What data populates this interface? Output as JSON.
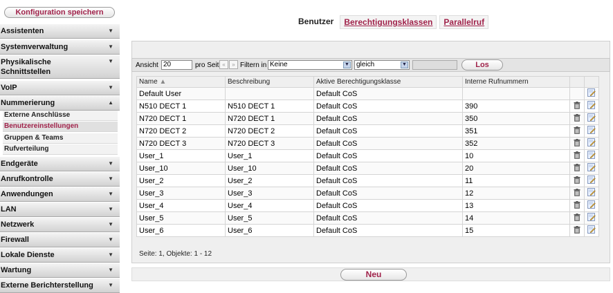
{
  "sidebar": {
    "save_label": "Konfiguration speichern",
    "items": [
      {
        "label": "Assistenten"
      },
      {
        "label": "Systemverwaltung"
      },
      {
        "label": "Physikalische Schnittstellen"
      },
      {
        "label": "VoIP"
      },
      {
        "label": "Nummerierung"
      },
      {
        "label": "Endgeräte"
      },
      {
        "label": "Anrufkontrolle"
      },
      {
        "label": "Anwendungen"
      },
      {
        "label": "LAN"
      },
      {
        "label": "Netzwerk"
      },
      {
        "label": "Firewall"
      },
      {
        "label": "Lokale Dienste"
      },
      {
        "label": "Wartung"
      },
      {
        "label": "Externe Berichterstellung"
      }
    ],
    "sub_items": [
      {
        "label": "Externe Anschlüsse"
      },
      {
        "label": "Benutzereinstellungen"
      },
      {
        "label": "Gruppen & Teams"
      },
      {
        "label": "Rufverteilung"
      }
    ]
  },
  "tabs": [
    {
      "label": "Benutzer"
    },
    {
      "label": "Berechtigungsklassen"
    },
    {
      "label": "Parallelruf"
    }
  ],
  "filter": {
    "view_label": "Ansicht",
    "view_value": "20",
    "per_page_label": "pro Seite",
    "filter_in_label": "Filtern in",
    "filter_field": "Keine",
    "operator": "gleich",
    "go_label": "Los"
  },
  "table": {
    "headers": [
      "Name",
      "Beschreibung",
      "Aktive Berechtigungsklasse",
      "Interne Rufnummern"
    ],
    "rows": [
      [
        "Default User",
        "",
        "Default CoS",
        ""
      ],
      [
        "N510 DECT 1",
        "N510 DECT 1",
        "Default CoS",
        "390"
      ],
      [
        "N720 DECT 1",
        "N720 DECT 1",
        "Default CoS",
        "350"
      ],
      [
        "N720 DECT 2",
        "N720 DECT 2",
        "Default CoS",
        "351"
      ],
      [
        "N720 DECT 3",
        "N720 DECT 3",
        "Default CoS",
        "352"
      ],
      [
        "User_1",
        "User_1",
        "Default CoS",
        "10"
      ],
      [
        "User_10",
        "User_10",
        "Default CoS",
        "20"
      ],
      [
        "User_2",
        "User_2",
        "Default CoS",
        "11"
      ],
      [
        "User_3",
        "User_3",
        "Default CoS",
        "12"
      ],
      [
        "User_4",
        "User_4",
        "Default CoS",
        "13"
      ],
      [
        "User_5",
        "User_5",
        "Default CoS",
        "14"
      ],
      [
        "User_6",
        "User_6",
        "Default CoS",
        "15"
      ]
    ],
    "footer": "Seite: 1, Objekte: 1 - 12"
  },
  "new_label": "Neu",
  "colors": {
    "accent": "#a0224a"
  }
}
